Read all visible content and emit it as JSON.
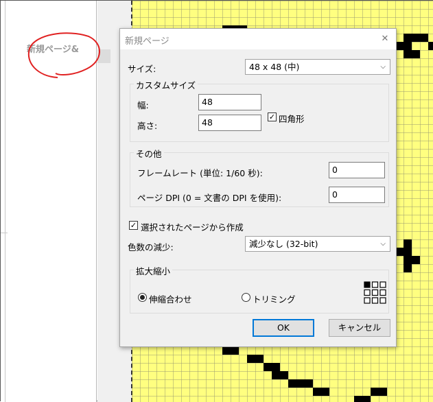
{
  "background": {
    "page_label": "新規ページ&",
    "canvas_color": "#ffff80",
    "grid_color": "#9a9a70",
    "pixel_color": "#000000"
  },
  "dialog": {
    "title": "新規ページ",
    "close_icon": "close-icon",
    "size_label": "サイズ:",
    "size_value": "48 x 48 (中)",
    "custom_size": {
      "title": "カスタムサイズ",
      "width_label": "幅:",
      "width_value": "48",
      "height_label": "高さ:",
      "height_value": "48",
      "square_label": "四角形",
      "square_checked": true
    },
    "other": {
      "title": "その他",
      "framerate_label": "フレームレート (単位: 1/60 秒):",
      "framerate_value": "0",
      "dpi_label": "ページ DPI (0 = 文書の DPI を使用):",
      "dpi_value": "0"
    },
    "create_from_selected_label": "選択されたページから作成",
    "create_from_selected_checked": true,
    "color_reduction_label": "色数の減少:",
    "color_reduction_value": "減少なし (32-bit)",
    "scaling": {
      "title": "拡大縮小",
      "stretch_label": "伸縮合わせ",
      "trim_label": "トリミング",
      "selected": "stretch",
      "anchor_icon": "anchor-grid-icon"
    },
    "ok_label": "OK",
    "cancel_label": "キャンセル"
  }
}
